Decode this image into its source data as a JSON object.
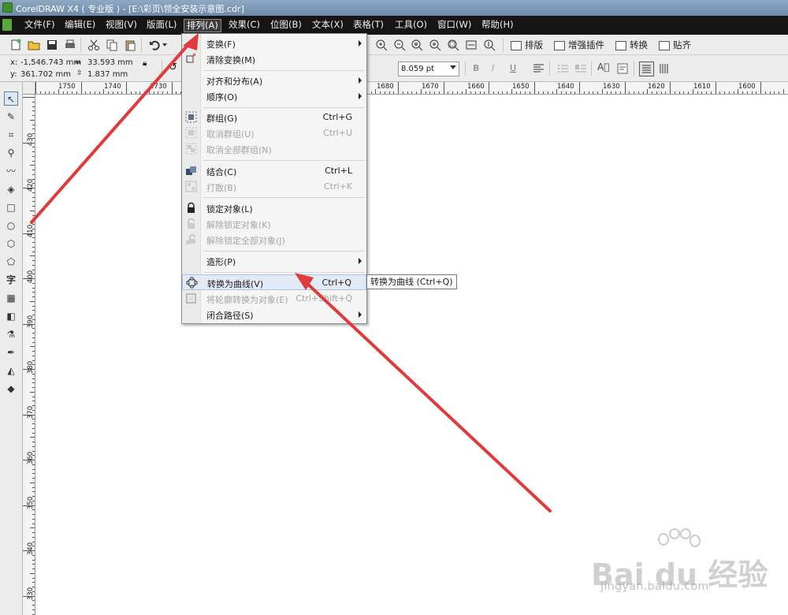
{
  "window": {
    "title": "CorelDRAW X4 ( 专业版 ) - [E:\\彩页\\领全安装示意图.cdr]"
  },
  "menubar": {
    "items": [
      {
        "label": "文件(F)"
      },
      {
        "label": "编辑(E)"
      },
      {
        "label": "视图(V)"
      },
      {
        "label": "版面(L)"
      },
      {
        "label": "排列(A)"
      },
      {
        "label": "效果(C)"
      },
      {
        "label": "位图(B)"
      },
      {
        "label": "文本(X)"
      },
      {
        "label": "表格(T)"
      },
      {
        "label": "工具(O)"
      },
      {
        "label": "窗口(W)"
      },
      {
        "label": "帮助(H)"
      }
    ]
  },
  "toolbar": {
    "plugins": [
      {
        "label": "排版"
      },
      {
        "label": "增强插件"
      },
      {
        "label": "转换"
      },
      {
        "label": "贴齐"
      }
    ]
  },
  "property_bar": {
    "x_label": "x:",
    "x_value": "-1,546.743 mm",
    "y_label": "y:",
    "y_value": "361.702 mm",
    "width_value": "33.593 mm",
    "height_value": "1.837 mm",
    "font_size": "8.059 pt"
  },
  "ruler_top": {
    "labels": [
      "1750",
      "1740",
      "1730",
      "1680",
      "1670",
      "1660",
      "1650",
      "1640",
      "1630",
      "1620",
      "1610",
      "1600"
    ]
  },
  "ruler_left": {
    "labels": [
      "430",
      "420",
      "410",
      "400",
      "390",
      "380",
      "370",
      "360",
      "350",
      "340",
      "330"
    ]
  },
  "toolbox": {
    "tools": [
      {
        "name": "pick-tool",
        "glyph": "↖"
      },
      {
        "name": "shape-tool",
        "glyph": "✎"
      },
      {
        "name": "crop-tool",
        "glyph": "⌗"
      },
      {
        "name": "zoom-tool",
        "glyph": "⚲"
      },
      {
        "name": "freehand-tool",
        "glyph": "〰"
      },
      {
        "name": "smart-fill-tool",
        "glyph": "◈"
      },
      {
        "name": "rectangle-tool",
        "glyph": "□"
      },
      {
        "name": "ellipse-tool",
        "glyph": "○"
      },
      {
        "name": "polygon-tool",
        "glyph": "⬡"
      },
      {
        "name": "basic-shapes-tool",
        "glyph": "⬠"
      },
      {
        "name": "text-tool",
        "glyph": "字"
      },
      {
        "name": "table-tool",
        "glyph": "▦"
      },
      {
        "name": "interactive-blend-tool",
        "glyph": "◧"
      },
      {
        "name": "eyedropper-tool",
        "glyph": "⚗"
      },
      {
        "name": "outline-tool",
        "glyph": "✒"
      },
      {
        "name": "fill-tool",
        "glyph": "◭"
      },
      {
        "name": "interactive-fill-tool",
        "glyph": "◆"
      }
    ]
  },
  "dropdown": {
    "items": [
      {
        "label": "变换(F)",
        "shortcut": "",
        "submenu": true,
        "disabled": false
      },
      {
        "label": "清除变换(M)",
        "shortcut": "",
        "submenu": false,
        "disabled": false
      },
      {
        "label": "对齐和分布(A)",
        "shortcut": "",
        "submenu": true,
        "disabled": false
      },
      {
        "label": "顺序(O)",
        "shortcut": "",
        "submenu": true,
        "disabled": false
      },
      {
        "label": "群组(G)",
        "shortcut": "Ctrl+G",
        "submenu": false,
        "disabled": false
      },
      {
        "label": "取消群组(U)",
        "shortcut": "Ctrl+U",
        "submenu": false,
        "disabled": true
      },
      {
        "label": "取消全部群组(N)",
        "shortcut": "",
        "submenu": false,
        "disabled": true
      },
      {
        "label": "结合(C)",
        "shortcut": "Ctrl+L",
        "submenu": false,
        "disabled": false
      },
      {
        "label": "打散(B)",
        "shortcut": "Ctrl+K",
        "submenu": false,
        "disabled": true
      },
      {
        "label": "锁定对象(L)",
        "shortcut": "",
        "submenu": false,
        "disabled": false
      },
      {
        "label": "解除锁定对象(K)",
        "shortcut": "",
        "submenu": false,
        "disabled": true
      },
      {
        "label": "解除锁定全部对象(J)",
        "shortcut": "",
        "submenu": false,
        "disabled": true
      },
      {
        "label": "造形(P)",
        "shortcut": "",
        "submenu": true,
        "disabled": false
      },
      {
        "label": "转换为曲线(V)",
        "shortcut": "Ctrl+Q",
        "submenu": false,
        "disabled": false
      },
      {
        "label": "将轮廓转换为对象(E)",
        "shortcut": "Ctrl+Shift+Q",
        "submenu": false,
        "disabled": true
      },
      {
        "label": "闭合路径(S)",
        "shortcut": "",
        "submenu": true,
        "disabled": false
      }
    ]
  },
  "tooltip": {
    "text": "转换为曲线 (Ctrl+Q)"
  },
  "watermark": {
    "main": "Bai du 经验",
    "sub": "jingyan.baidu.com"
  },
  "colors": {
    "annotation_arrow": "#e03a3a",
    "menubar_bg": "#151515",
    "menu_hover": "#e2ebf5"
  }
}
